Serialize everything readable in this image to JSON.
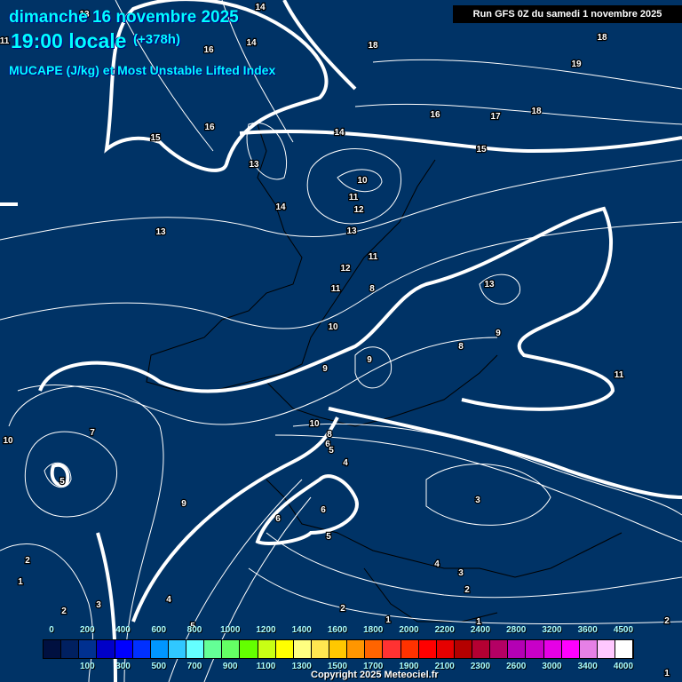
{
  "header": {
    "date": "dimanche 16 novembre 2025",
    "time": "19:00 locale",
    "lead": "(+378h)",
    "parameter": "MUCAPE (J/kg) et Most Unstable Lifted Index",
    "run": "Run GFS 0Z du samedi 1 novembre 2025"
  },
  "colors": {
    "background": "#003366",
    "contour": "#ffffff",
    "scale": [
      "#001040",
      "#002060",
      "#003090",
      "#0000c8",
      "#0000ff",
      "#0030ff",
      "#0096ff",
      "#30c8ff",
      "#64ffff",
      "#64ff96",
      "#64ff64",
      "#64ff00",
      "#c8ff14",
      "#ffff00",
      "#ffff80",
      "#ffe650",
      "#ffc800",
      "#ff9600",
      "#ff6400",
      "#ff3232",
      "#ff3200",
      "#ff0000",
      "#e60000",
      "#b40000",
      "#b40032",
      "#b40064",
      "#b400b4",
      "#c800c8",
      "#e600e6",
      "#ff00ff",
      "#e680e6",
      "#ffc8ff",
      "#ffffff"
    ]
  },
  "legend": {
    "top_labels": [
      "0",
      "200",
      "400",
      "600",
      "800",
      "1000",
      "1200",
      "1400",
      "1600",
      "1800",
      "2000",
      "2200",
      "2400",
      "2800",
      "3200",
      "3600",
      "4500"
    ],
    "bottom_labels": [
      "100",
      "300",
      "500",
      "700",
      "900",
      "1100",
      "1300",
      "1500",
      "1700",
      "1900",
      "2100",
      "2300",
      "2600",
      "3000",
      "3400",
      "4000"
    ]
  },
  "contour_labels": [
    "14",
    "13",
    "16",
    "14",
    "18",
    "18",
    "19",
    "16",
    "17",
    "18",
    "15",
    "15",
    "16",
    "13",
    "14",
    "10",
    "11",
    "12",
    "14",
    "13",
    "13",
    "12",
    "11",
    "8",
    "13",
    "9",
    "8",
    "10",
    "9",
    "9",
    "11",
    "10",
    "8",
    "6",
    "5",
    "4",
    "7",
    "5",
    "9",
    "6",
    "6",
    "5",
    "3",
    "4",
    "3",
    "2",
    "1",
    "2",
    "4",
    "5",
    "3",
    "2",
    "2",
    "1",
    "1",
    "2",
    "1",
    "10",
    "11",
    "11"
  ],
  "copyright": "Copyright 2025 Meteociel.fr"
}
